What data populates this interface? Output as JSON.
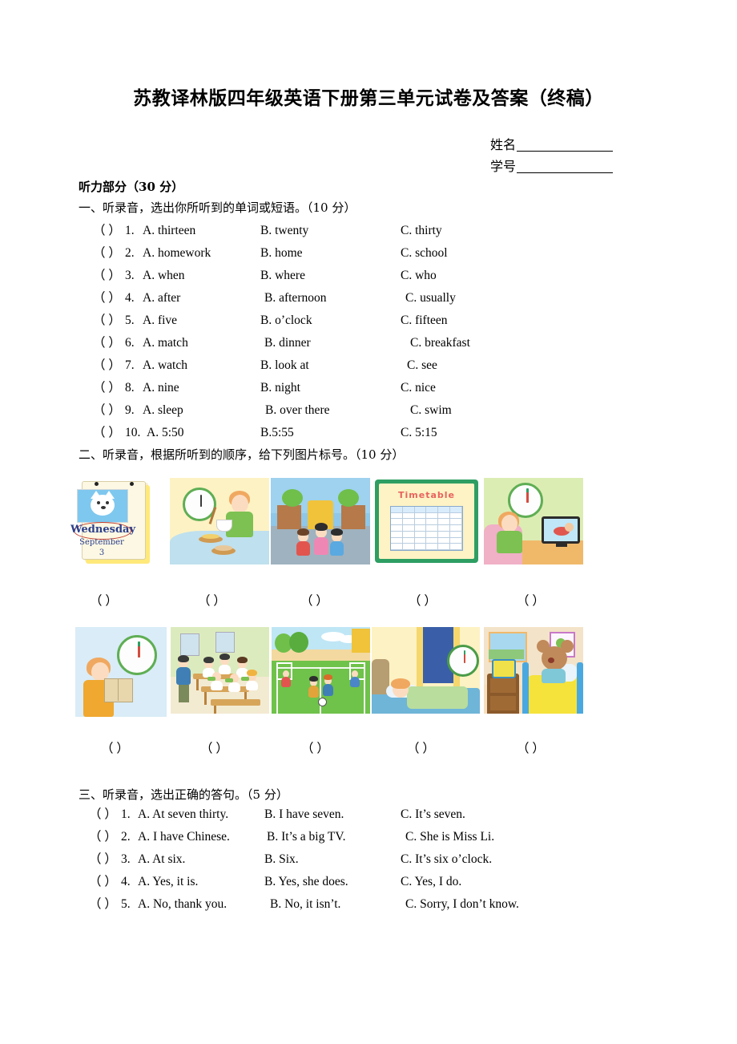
{
  "document": {
    "title": "苏教译林版四年级英语下册第三单元试卷及答案（终稿）"
  },
  "student_fields": {
    "name_label": "姓名",
    "id_label": "学号"
  },
  "listening_part": {
    "heading": "听力部分（30 分）"
  },
  "section_one": {
    "heading": "一、听录音，选出你所听到的单词或短语。（10 分）",
    "bracket": "（    ）",
    "questions": [
      {
        "num": "1.",
        "a": "A. thirteen",
        "b": "B. twenty",
        "c": "C. thirty"
      },
      {
        "num": "2.",
        "a": "A. homework",
        "b": "B. home",
        "c": "C. school"
      },
      {
        "num": "3.",
        "a": "A. when",
        "b": "B. where",
        "c": "C. who"
      },
      {
        "num": "4.",
        "a": "A. after",
        "b": "B. afternoon",
        "c": "C. usually"
      },
      {
        "num": "5.",
        "a": "A. five",
        "b": "B. o’clock",
        "c": "C. fifteen"
      },
      {
        "num": "6.",
        "a": "A. match",
        "b": "B. dinner",
        "c": "C. breakfast"
      },
      {
        "num": "7.",
        "a": "A. watch",
        "b": "B. look at",
        "c": "C. see"
      },
      {
        "num": "8.",
        "a": "A. nine",
        "b": "B. night",
        "c": "C. nice"
      },
      {
        "num": "9.",
        "a": "A. sleep",
        "b": "B. over there",
        "c": "C. swim"
      },
      {
        "num": "10.",
        "a": "A. 5:50",
        "b": "B.5:55",
        "c": "C. 5:15"
      }
    ]
  },
  "section_two": {
    "heading": "二、听录音，根据所听到的顺序，给下列图片标号。（10 分）",
    "answer_bracket": "（      ）",
    "row_one_pictures": [
      {
        "name": "calendar-wednesday",
        "caption_day": "Wednesday",
        "caption_month": "September",
        "caption_date": "3"
      },
      {
        "name": "boy-eating-breakfast-with-clock"
      },
      {
        "name": "children-at-school-gate"
      },
      {
        "name": "timetable-board",
        "caption": "Timetable"
      },
      {
        "name": "girl-watching-tv-with-clock"
      }
    ],
    "row_two_pictures": [
      {
        "name": "boy-reading-book-with-clock"
      },
      {
        "name": "students-having-lunch-in-classroom"
      },
      {
        "name": "children-playing-football-match"
      },
      {
        "name": "child-sleeping-with-clock"
      },
      {
        "name": "mouse-waking-up-with-alarm-clock"
      }
    ],
    "row_one_answers": [
      "（    ）",
      "（    ）",
      "（    ）",
      "（    ）",
      "（    ）"
    ],
    "row_two_answers": [
      "（    ）",
      "（    ）",
      "（    ）",
      "（    ）",
      "（    ）"
    ]
  },
  "section_three": {
    "heading": "三、听录音，选出正确的答句。（5 分）",
    "bracket": "（    ）",
    "questions": [
      {
        "num": "1.",
        "a": "A. At seven thirty.",
        "b": "B. I have seven.",
        "c": "C. It’s seven."
      },
      {
        "num": "2.",
        "a": "A. I have Chinese.",
        "b": "B. It’s a big TV.",
        "c": "C. She is Miss Li."
      },
      {
        "num": "3.",
        "a": "A. At six.",
        "b": "B. Six.",
        "c": "C. It’s six o’clock."
      },
      {
        "num": "4.",
        "a": "A. Yes, it is.",
        "b": "B. Yes, she does.",
        "c": "C. Yes, I do."
      },
      {
        "num": "5.",
        "a": "A. No, thank you.",
        "b": "B. No, it isn’t.",
        "c": "C. Sorry, I don’t know."
      }
    ]
  },
  "colors": {
    "page_background": "#ffffff",
    "text": "#000000",
    "timetable_border": "#2e9e63",
    "timetable_title": "#e8625f",
    "calendar_paper": "#fdf8e3",
    "calendar_highlight": "#c0392b",
    "clock_ring": "#5fae54"
  }
}
